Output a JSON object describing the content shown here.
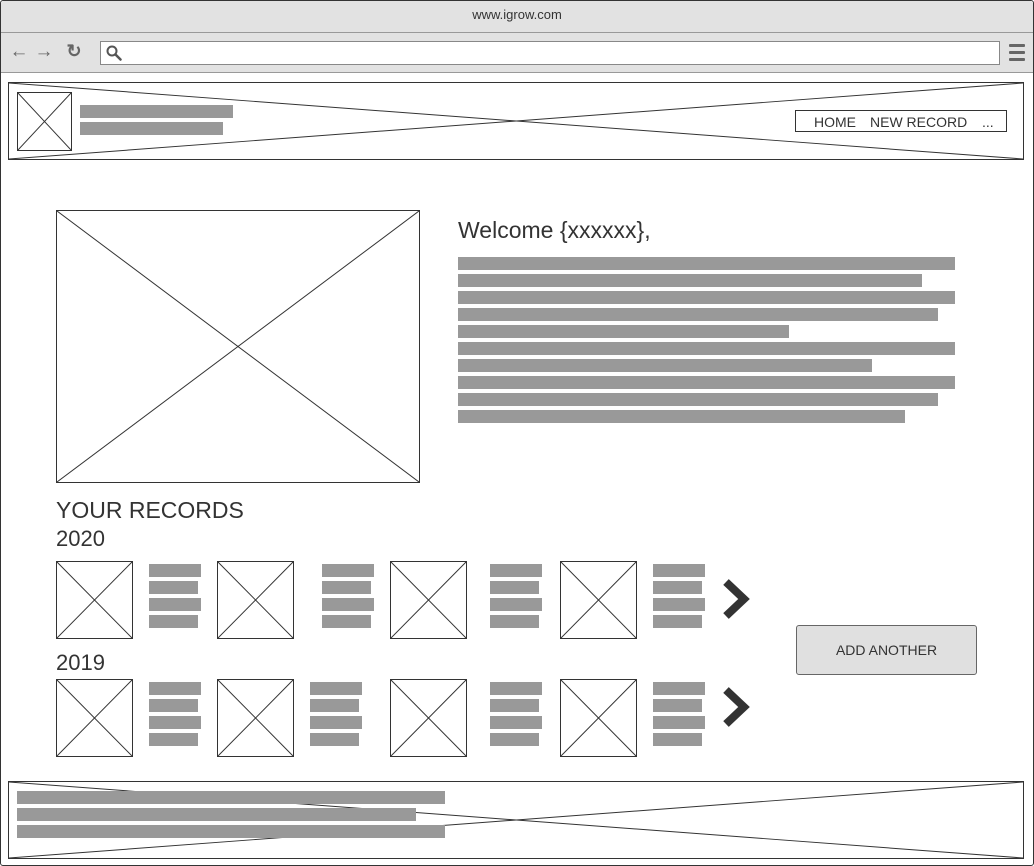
{
  "browser": {
    "url": "www.igrow.com",
    "back_icon": "arrow-left-icon",
    "forward_icon": "arrow-right-icon",
    "reload_icon": "reload-icon",
    "search_icon": "search-icon",
    "menu_icon": "hamburger-menu-icon"
  },
  "header": {
    "nav": {
      "home": "HOME",
      "new_record": "NEW RECORD",
      "more": "..."
    }
  },
  "main": {
    "welcome": "Welcome {xxxxxx},"
  },
  "records": {
    "heading": "YOUR RECORDS",
    "groups": [
      {
        "year": "2020"
      },
      {
        "year": "2019"
      }
    ],
    "add_button": "ADD ANOTHER"
  }
}
